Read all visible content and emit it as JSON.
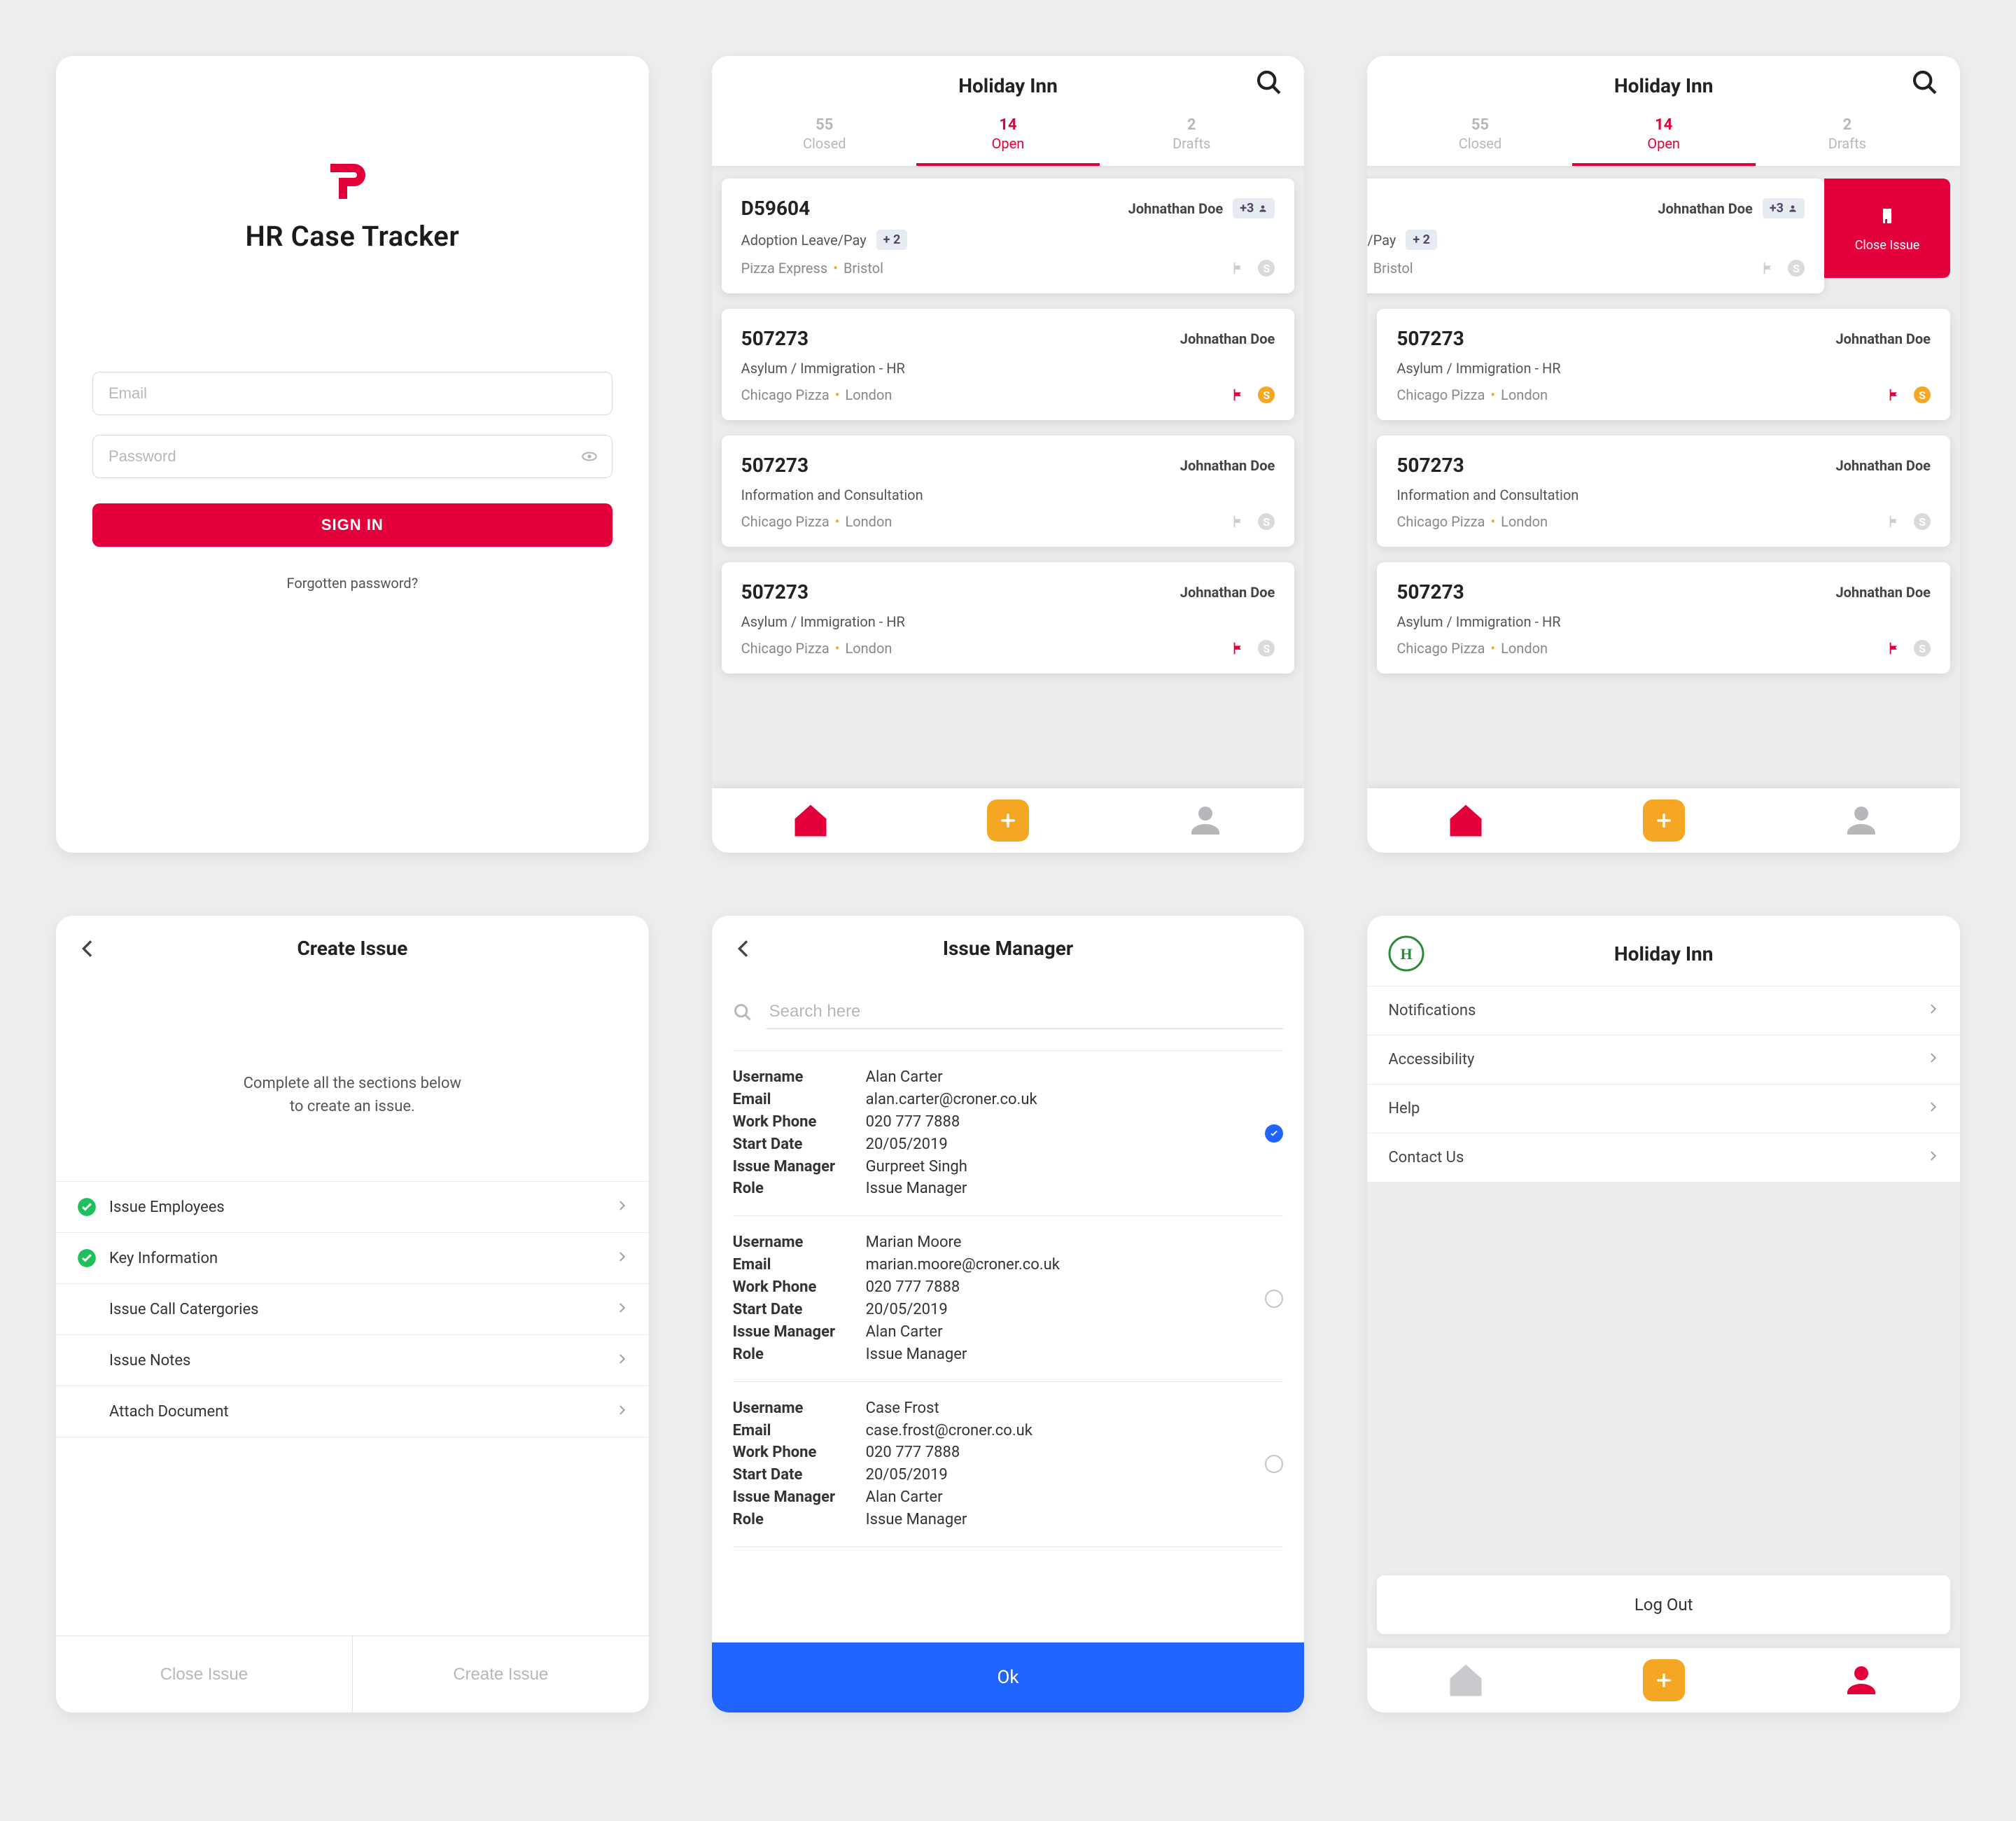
{
  "login": {
    "title": "HR Case Tracker",
    "email_ph": "Email",
    "password_ph": "Password",
    "signin": "SIGN IN",
    "forgot": "Forgotten password?"
  },
  "list": {
    "title": "Holiday Inn",
    "tabs": {
      "closed": {
        "count": "55",
        "label": "Closed"
      },
      "open": {
        "count": "14",
        "label": "Open"
      },
      "drafts": {
        "count": "2",
        "label": "Drafts"
      }
    },
    "close_swipe": "Close Issue",
    "cases": [
      {
        "id": "D59604",
        "assignee": "Johnathan Doe",
        "extra_people": "+3",
        "cat": "Adoption Leave/Pay",
        "cat_extra": "+ 2",
        "company": "Pizza Express",
        "city": "Bristol",
        "flag": "off",
        "coin": "off"
      },
      {
        "id": "507273",
        "assignee": "Johnathan Doe",
        "cat": "Asylum / Immigration - HR",
        "company": "Chicago Pizza",
        "city": "London",
        "flag": "red",
        "coin": "gold"
      },
      {
        "id": "507273",
        "assignee": "Johnathan Doe",
        "cat": "Information and Consultation",
        "company": "Chicago Pizza",
        "city": "London",
        "flag": "off",
        "coin": "off"
      },
      {
        "id": "507273",
        "assignee": "Johnathan Doe",
        "cat": "Asylum / Immigration - HR",
        "company": "Chicago Pizza",
        "city": "London",
        "flag": "red",
        "coin": "off"
      }
    ]
  },
  "create": {
    "title": "Create Issue",
    "intro1": "Complete all the sections below",
    "intro2": "to create an issue.",
    "sections": [
      {
        "label": "Issue Employees",
        "done": true
      },
      {
        "label": "Key Information",
        "done": true
      },
      {
        "label": "Issue Call Catergories",
        "done": false
      },
      {
        "label": "Issue Notes",
        "done": false
      },
      {
        "label": "Attach Document",
        "done": false
      }
    ],
    "close": "Close Issue",
    "submit": "Create Issue"
  },
  "im": {
    "title": "Issue Manager",
    "search_ph": "Search here",
    "labels": {
      "user": "Username",
      "email": "Email",
      "phone": "Work Phone",
      "start": "Start Date",
      "mgr": "Issue Manager",
      "role": "Role"
    },
    "ok": "Ok",
    "people": [
      {
        "user": "Alan Carter",
        "email": "alan.carter@croner.co.uk",
        "phone": "020 777 7888",
        "start": "20/05/2019",
        "mgr": "Gurpreet Singh",
        "role": "Issue Manager",
        "sel": true
      },
      {
        "user": "Marian Moore",
        "email": "marian.moore@croner.co.uk",
        "phone": "020 777 7888",
        "start": "20/05/2019",
        "mgr": "Alan Carter",
        "role": "Issue Manager",
        "sel": false
      },
      {
        "user": "Case Frost",
        "email": "case.frost@croner.co.uk",
        "phone": "020 777 7888",
        "start": "20/05/2019",
        "mgr": "Alan Carter",
        "role": "Issue Manager",
        "sel": false
      }
    ]
  },
  "settings": {
    "brand": "Holiday Inn",
    "items": [
      "Notifications",
      "Accessibility",
      "Help",
      "Contact Us"
    ],
    "logout": "Log Out"
  }
}
